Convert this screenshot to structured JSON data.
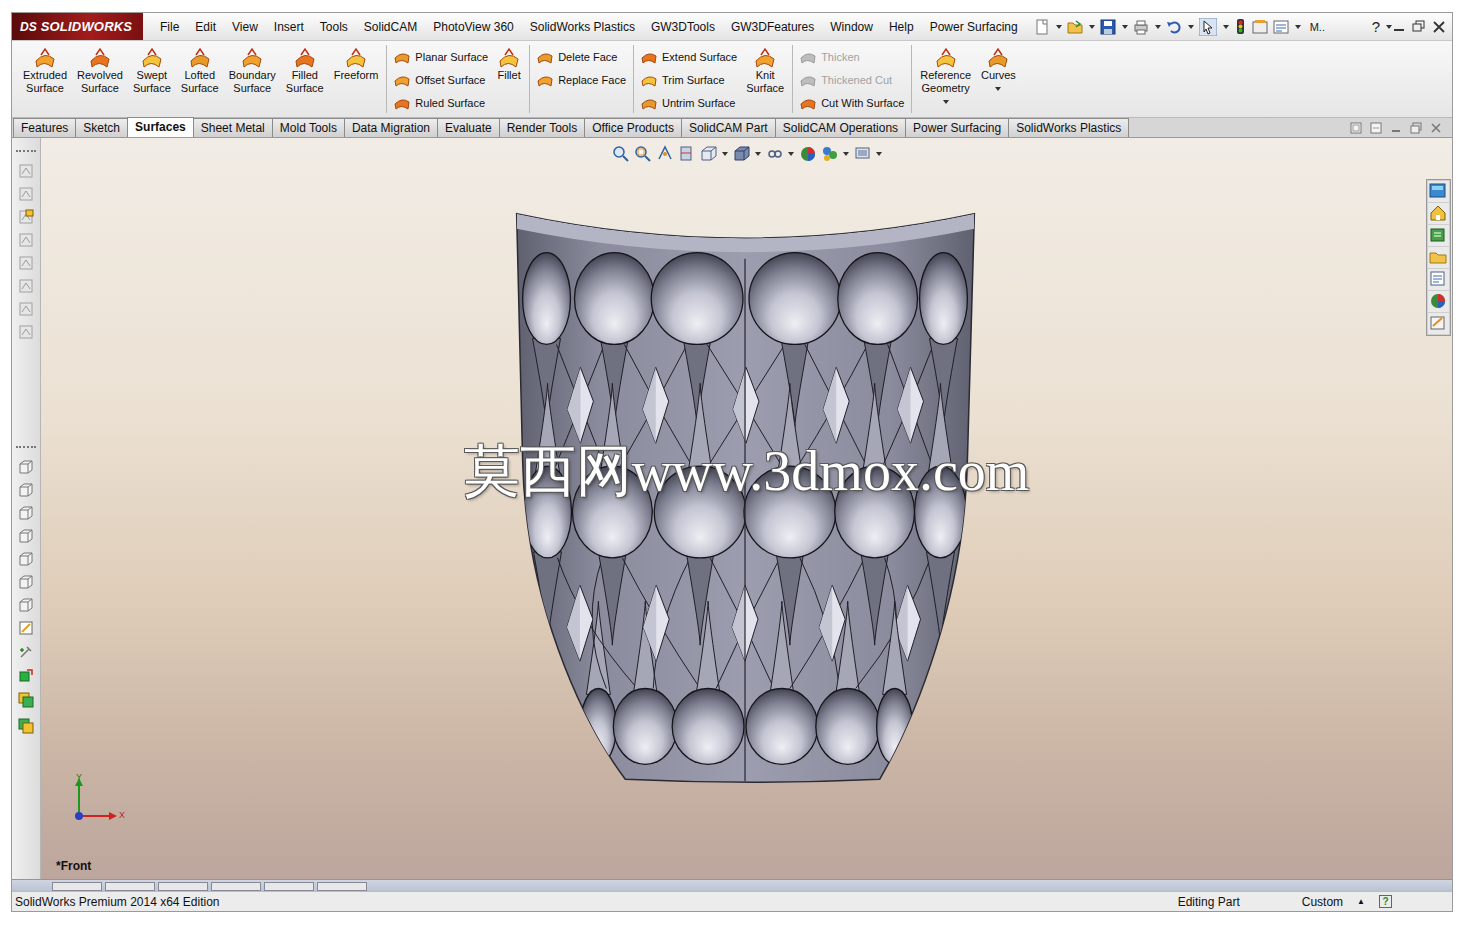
{
  "app": {
    "logo_prefix": "DS",
    "logo": "SOLIDWORKS"
  },
  "menu": [
    "File",
    "Edit",
    "View",
    "Insert",
    "Tools",
    "SolidCAM",
    "PhotoView 360",
    "SolidWorks Plastics",
    "GW3DTools",
    "GW3DFeatures",
    "Window",
    "Help",
    "Power Surfacing"
  ],
  "title_bar": {
    "more": "M..",
    "help": "?"
  },
  "ribbon": {
    "sections": [
      {
        "groups": [
          {
            "kind": "large",
            "items": [
              {
                "label": "Extruded Surface",
                "disabled": false,
                "dropdown": false
              },
              {
                "label": "Revolved Surface",
                "disabled": false,
                "dropdown": false
              },
              {
                "label": "Swept Surface",
                "disabled": false,
                "dropdown": false
              },
              {
                "label": "Lofted Surface",
                "disabled": false,
                "dropdown": false
              },
              {
                "label": "Boundary Surface",
                "disabled": false,
                "dropdown": false
              },
              {
                "label": "Filled Surface",
                "disabled": false,
                "dropdown": false
              },
              {
                "label": "Freeform",
                "disabled": false,
                "dropdown": false
              }
            ]
          }
        ]
      },
      {
        "groups": [
          {
            "kind": "stack",
            "items": [
              {
                "label": "Planar Surface",
                "disabled": false,
                "dropdown": false
              },
              {
                "label": "Offset Surface",
                "disabled": false,
                "dropdown": false
              },
              {
                "label": "Ruled Surface",
                "disabled": false,
                "dropdown": false
              }
            ]
          },
          {
            "kind": "large",
            "items": [
              {
                "label": "Fillet",
                "disabled": false,
                "dropdown": false
              }
            ]
          }
        ]
      },
      {
        "groups": [
          {
            "kind": "stack",
            "items": [
              {
                "label": "Delete Face",
                "disabled": false,
                "dropdown": false
              },
              {
                "label": "Replace Face",
                "disabled": false,
                "dropdown": false
              }
            ]
          }
        ]
      },
      {
        "groups": [
          {
            "kind": "stack",
            "items": [
              {
                "label": "Extend Surface",
                "disabled": false,
                "dropdown": false
              },
              {
                "label": "Trim Surface",
                "disabled": false,
                "dropdown": false
              },
              {
                "label": "Untrim Surface",
                "disabled": false,
                "dropdown": false
              }
            ]
          },
          {
            "kind": "large",
            "items": [
              {
                "label": "Knit Surface",
                "disabled": false,
                "dropdown": false
              }
            ]
          }
        ]
      },
      {
        "groups": [
          {
            "kind": "stack",
            "items": [
              {
                "label": "Thicken",
                "disabled": true,
                "dropdown": false
              },
              {
                "label": "Thickened Cut",
                "disabled": true,
                "dropdown": false
              },
              {
                "label": "Cut With Surface",
                "disabled": false,
                "dropdown": false
              }
            ]
          }
        ]
      },
      {
        "groups": [
          {
            "kind": "large",
            "items": [
              {
                "label": "Reference Geometry",
                "disabled": false,
                "dropdown": true
              },
              {
                "label": "Curves",
                "disabled": false,
                "dropdown": true
              }
            ]
          }
        ]
      }
    ]
  },
  "tabs": [
    {
      "label": "Features",
      "selected": false
    },
    {
      "label": "Sketch",
      "selected": false
    },
    {
      "label": "Surfaces",
      "selected": true
    },
    {
      "label": "Sheet Metal",
      "selected": false
    },
    {
      "label": "Mold Tools",
      "selected": false
    },
    {
      "label": "Data Migration",
      "selected": false
    },
    {
      "label": "Evaluate",
      "selected": false
    },
    {
      "label": "Render Tools",
      "selected": false
    },
    {
      "label": "Office Products",
      "selected": false
    },
    {
      "label": "SolidCAM Part",
      "selected": false
    },
    {
      "label": "SolidCAM Operations",
      "selected": false
    },
    {
      "label": "Power Surfacing",
      "selected": false
    },
    {
      "label": "SolidWorks Plastics",
      "selected": false
    }
  ],
  "viewport": {
    "view_label": "*Front",
    "watermark": "莫西网www.3dmox.com",
    "triad": {
      "y": "Y",
      "x": "X"
    }
  },
  "status_bar": {
    "edition": "SolidWorks Premium 2014 x64 Edition",
    "mode": "Editing Part",
    "units": "Custom",
    "units_arrow": "▲",
    "help": "?"
  }
}
